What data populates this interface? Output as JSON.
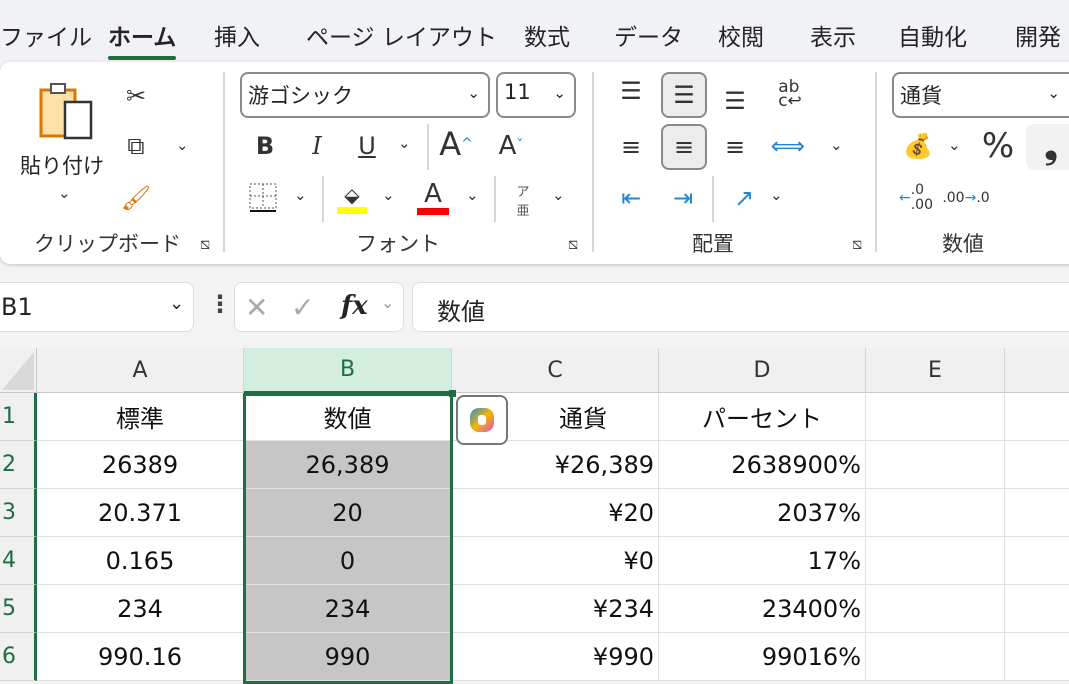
{
  "tabs": [
    "ファイル",
    "ホーム",
    "挿入",
    "ページ レイアウト",
    "数式",
    "データ",
    "校閲",
    "表示",
    "自動化",
    "開発"
  ],
  "active_tab": "ホーム",
  "ribbon": {
    "clipboard": {
      "label": "クリップボード",
      "paste": "貼り付け"
    },
    "font": {
      "label": "フォント",
      "font_name": "游ゴシック",
      "font_size": "11",
      "bold": "B",
      "italic": "I",
      "underline": "U",
      "grow": "A",
      "shrink": "A",
      "furigana_top": "ア",
      "furigana_bottom": "亜",
      "fill_color": "#ffff00",
      "font_color": "#ff0000"
    },
    "alignment": {
      "label": "配置"
    },
    "number": {
      "label": "数値",
      "format": "通貨",
      "percent": "%",
      "comma": "❟"
    }
  },
  "formula_bar": {
    "name_box": "B1",
    "fx": "fx",
    "content": "数値"
  },
  "columns": [
    "A",
    "B",
    "C",
    "D",
    "E"
  ],
  "rows": [
    {
      "n": "1",
      "cells": [
        "標準",
        "数値",
        "通貨",
        "パーセント",
        ""
      ]
    },
    {
      "n": "2",
      "cells": [
        "26389",
        "26,389",
        "¥26,389",
        "2638900%",
        ""
      ]
    },
    {
      "n": "3",
      "cells": [
        "20.371",
        "20",
        "¥20",
        "2037%",
        ""
      ]
    },
    {
      "n": "4",
      "cells": [
        "0.165",
        "0",
        "¥0",
        "17%",
        ""
      ]
    },
    {
      "n": "5",
      "cells": [
        "234",
        "234",
        "¥234",
        "23400%",
        ""
      ]
    },
    {
      "n": "6",
      "cells": [
        "990.16",
        "990",
        "¥990",
        "99016%",
        ""
      ]
    }
  ],
  "selection": "B1:B6",
  "colors": {
    "accent": "#1e6e42",
    "selected_fill": "#c6c6c6",
    "selected_header": "#d3eedf"
  }
}
